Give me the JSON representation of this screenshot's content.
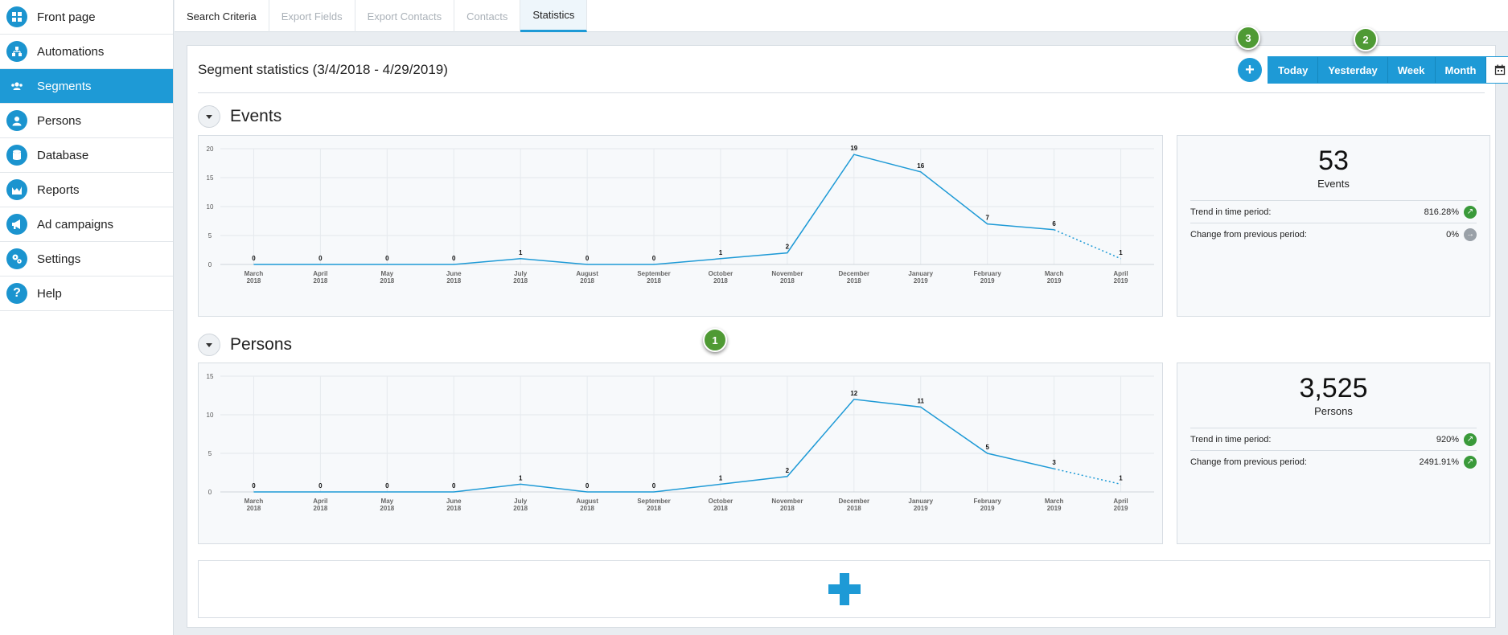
{
  "sidebar": {
    "items": [
      {
        "label": "Front page",
        "icon": "grid-icon",
        "active": false
      },
      {
        "label": "Automations",
        "icon": "org-chart-icon",
        "active": false
      },
      {
        "label": "Segments",
        "icon": "group-icon",
        "active": true
      },
      {
        "label": "Persons",
        "icon": "person-icon",
        "active": false
      },
      {
        "label": "Database",
        "icon": "database-icon",
        "active": false
      },
      {
        "label": "Reports",
        "icon": "chart-icon",
        "active": false
      },
      {
        "label": "Ad campaigns",
        "icon": "megaphone-icon",
        "active": false
      },
      {
        "label": "Settings",
        "icon": "gears-icon",
        "active": false
      },
      {
        "label": "Help",
        "icon": "question-icon",
        "active": false
      }
    ]
  },
  "tabs": [
    {
      "label": "Search Criteria"
    },
    {
      "label": "Export Fields"
    },
    {
      "label": "Export Contacts"
    },
    {
      "label": "Contacts"
    },
    {
      "label": "Statistics"
    }
  ],
  "panel": {
    "title": "Segment statistics (3/4/2018 - 4/29/2019)",
    "add_icon": "plus-icon",
    "range_buttons": [
      "Today",
      "Yesterday",
      "Week",
      "Month"
    ],
    "calendar_icon": "calendar-icon"
  },
  "badges": {
    "one": "1",
    "two": "2",
    "three": "3"
  },
  "colors": {
    "accent": "#1e9ad6",
    "badge": "#4f9a34",
    "trend_up": "#3a9a3a",
    "trend_flat": "#9aa1a8"
  },
  "events": {
    "title": "Events",
    "stat_value": "53",
    "stat_unit": "Events",
    "trend_label": "Trend in time period:",
    "trend_value": "816.28%",
    "change_label": "Change from previous period:",
    "change_value": "0%"
  },
  "persons": {
    "title": "Persons",
    "stat_value": "3,525",
    "stat_unit": "Persons",
    "trend_label": "Trend in time period:",
    "trend_value": "920%",
    "change_label": "Change from previous period:",
    "change_value": "2491.91%"
  },
  "chart_data": [
    {
      "type": "line",
      "title": "Events",
      "categories": [
        [
          "March",
          "2018"
        ],
        [
          "April",
          "2018"
        ],
        [
          "May",
          "2018"
        ],
        [
          "June",
          "2018"
        ],
        [
          "July",
          "2018"
        ],
        [
          "August",
          "2018"
        ],
        [
          "September",
          "2018"
        ],
        [
          "October",
          "2018"
        ],
        [
          "November",
          "2018"
        ],
        [
          "December",
          "2018"
        ],
        [
          "January",
          "2019"
        ],
        [
          "February",
          "2019"
        ],
        [
          "March",
          "2019"
        ],
        [
          "April",
          "2019"
        ]
      ],
      "values": [
        0,
        0,
        0,
        0,
        1,
        0,
        0,
        1,
        2,
        19,
        16,
        7,
        6,
        1
      ],
      "ylim": [
        0,
        20
      ],
      "yticks": [
        0,
        5,
        10,
        15,
        20
      ],
      "grid": true,
      "partial_last_segment": "dotted",
      "color": "#1e9ad6"
    },
    {
      "type": "line",
      "title": "Persons",
      "categories": [
        [
          "March",
          "2018"
        ],
        [
          "April",
          "2018"
        ],
        [
          "May",
          "2018"
        ],
        [
          "June",
          "2018"
        ],
        [
          "July",
          "2018"
        ],
        [
          "August",
          "2018"
        ],
        [
          "September",
          "2018"
        ],
        [
          "October",
          "2018"
        ],
        [
          "November",
          "2018"
        ],
        [
          "December",
          "2018"
        ],
        [
          "January",
          "2019"
        ],
        [
          "February",
          "2019"
        ],
        [
          "March",
          "2019"
        ],
        [
          "April",
          "2019"
        ]
      ],
      "values": [
        0,
        0,
        0,
        0,
        1,
        0,
        0,
        1,
        2,
        12,
        11,
        5,
        3,
        1
      ],
      "ylim": [
        0,
        15
      ],
      "yticks": [
        0,
        5,
        10,
        15
      ],
      "grid": true,
      "partial_last_segment": "dotted",
      "color": "#1e9ad6"
    }
  ]
}
